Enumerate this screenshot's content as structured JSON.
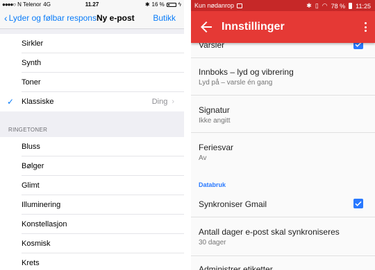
{
  "ios": {
    "status": {
      "signal": "●●●●○",
      "carrier": "N Telenor",
      "network": "4G",
      "time": "11.27",
      "battery": "16 %"
    },
    "nav": {
      "back_label": "Lyder og følbar respons",
      "title": "Ny e-post",
      "right_label": "Butikk"
    },
    "alert_tones": [
      {
        "label": "Sirkler"
      },
      {
        "label": "Synth"
      },
      {
        "label": "Toner"
      },
      {
        "label": "Klassiske",
        "detail": "Ding",
        "checked": true
      }
    ],
    "ringtones_header": "RINGETONER",
    "ringtones": [
      {
        "label": "Bluss"
      },
      {
        "label": "Bølger"
      },
      {
        "label": "Glimt"
      },
      {
        "label": "Illuminering"
      },
      {
        "label": "Konstellasjon"
      },
      {
        "label": "Kosmisk"
      },
      {
        "label": "Krets"
      }
    ]
  },
  "android": {
    "status": {
      "carrier": "Kun nødanrop",
      "battery": "78 %",
      "time": "11:25"
    },
    "toolbar": {
      "title": "Innstillinger"
    },
    "items": {
      "varsler": {
        "title": "Varsler",
        "checked": true
      },
      "innboks": {
        "title": "Innboks – lyd og vibrering",
        "summary": "Lyd på – varsle én gang"
      },
      "signatur": {
        "title": "Signatur",
        "summary": "Ikke angitt"
      },
      "feriesvar": {
        "title": "Feriesvar",
        "summary": "Av"
      },
      "databruk_header": "Databruk",
      "sync": {
        "title": "Synkroniser Gmail",
        "checked": true
      },
      "days": {
        "title": "Antall dager e-post skal synkroniseres",
        "summary": "30 dager"
      },
      "labels": {
        "title": "Administrer etiketter"
      }
    },
    "colors": {
      "toolbar": "#e53935",
      "status": "#c62828",
      "accent": "#2979ff"
    }
  }
}
